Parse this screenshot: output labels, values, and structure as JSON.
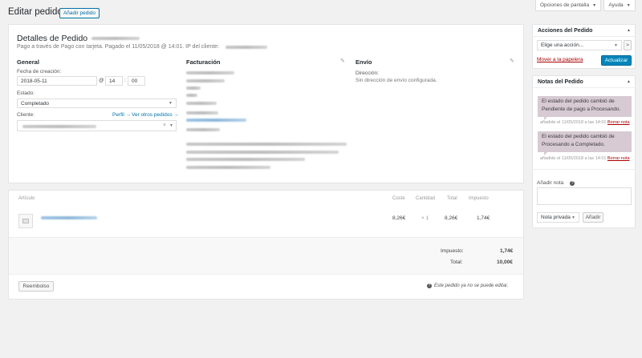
{
  "header": {
    "title": "Editar pedido",
    "add_order_label": "Añadir pedido",
    "screen_options_label": "Opciones de pantalla",
    "help_label": "Ayuda"
  },
  "order": {
    "title": "Detalles de Pedido",
    "subtitle": "Pago a través de Pago con tarjeta. Pagado el 11/05/2018 @ 14:01. IP del cliente:",
    "general": {
      "heading": "General",
      "created_label": "Fecha de creación:",
      "date": "2018-05-11",
      "at": "@",
      "hour": "14",
      "colon": ":",
      "minute": "00",
      "status_label": "Estado:",
      "status_value": "Completado",
      "customer_label": "Cliente:",
      "profile_link": "Perfil →",
      "other_orders_link": "Ver otros pedidos →",
      "clear_glyph": "×"
    },
    "billing": {
      "heading": "Facturación"
    },
    "shipping": {
      "heading": "Envío",
      "address_label": "Dirección:",
      "address_value": "Sin dirección de envío configurada."
    }
  },
  "items": {
    "columns": [
      "Artículo",
      "Coste",
      "Cantidad",
      "Total",
      "Impuesto"
    ],
    "rows": [
      {
        "cost": "8,26€",
        "qty": "× 1",
        "total": "8,26€",
        "tax": "1,74€"
      }
    ],
    "tax_label": "Impuesto:",
    "tax_value": "1,74€",
    "total_label": "Total:",
    "total_value": "10,00€",
    "refund_label": "Reembolso",
    "not_editable": "Este pedido ya no se puede editar."
  },
  "actions": {
    "heading": "Acciones del Pedido",
    "select_value": "Elige una acción...",
    "go_glyph": ">",
    "trash_link": "Mover a la papelera",
    "update_label": "Actualizar"
  },
  "notes": {
    "heading": "Notas del Pedido",
    "list": [
      {
        "text": "El estado del pedido cambió de Pendiente de pago a Procesando.",
        "meta": "añadido el 11/05/2018 a las 14:01",
        "delete": "Borrar nota"
      },
      {
        "text": "El estado del pedido cambió de Procesando a Completado.",
        "meta": "añadido el 11/05/2018 a las 14:01",
        "delete": "Borrar nota"
      }
    ],
    "add_label": "Añadir nota",
    "help_glyph": "?",
    "type_value": "Nota privada",
    "add_button": "Añadir"
  },
  "icons": {
    "edit": "pencil-icon",
    "collapse": "triangle-up-icon",
    "dropdown": "triangle-down-icon",
    "info": "info-icon",
    "product": "image-placeholder-icon"
  }
}
